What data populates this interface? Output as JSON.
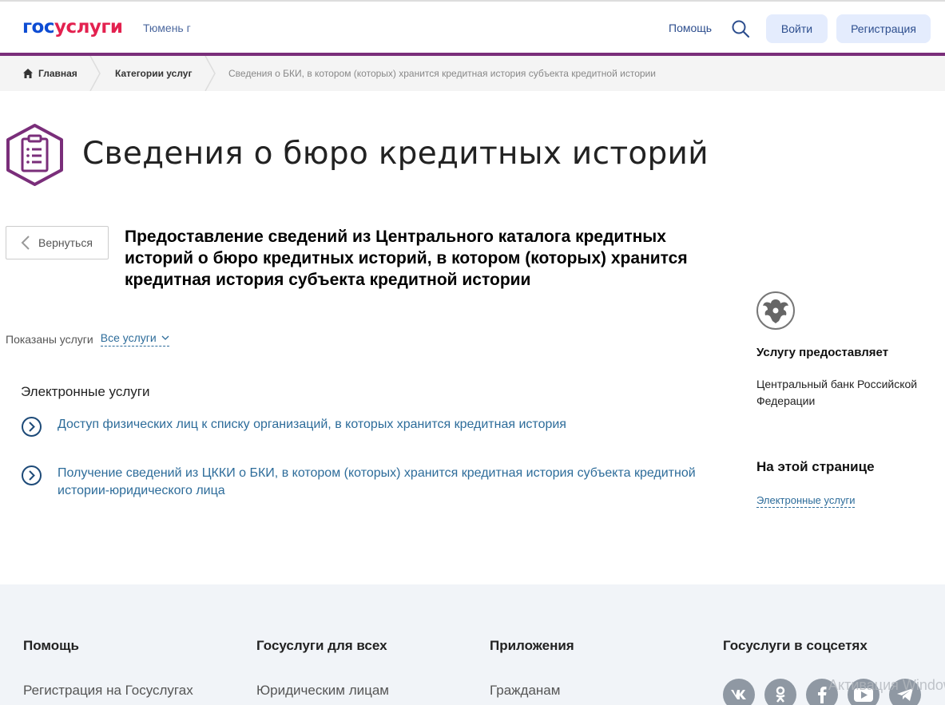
{
  "header": {
    "logo_part1": "гос",
    "logo_part2": "услуги",
    "city": "Тюмень г",
    "help": "Помощь",
    "login": "Войти",
    "register": "Регистрация"
  },
  "breadcrumbs": {
    "home": "Главная",
    "categories": "Категории услуг",
    "current": "Сведения о БКИ, в котором (которых) хранится кредитная история субъекта кредитной истории"
  },
  "page": {
    "title": "Сведения о бюро кредитных историй",
    "back": "Вернуться",
    "subtitle": "Предоставление сведений из Центрального каталога кредитных историй о бюро кредитных историй, в котором (которых) хранится кредитная история субъекта кредитной истории",
    "shown_label": "Показаны услуги",
    "filter": "Все услуги",
    "section_title": "Электронные услуги",
    "services": [
      "Доступ физических лиц к списку организаций, в которых хранится кредитная история",
      "Получение сведений из ЦККИ о БКИ, в котором (которых) хранится кредитная история субъекта кредитной истории-юридического лица"
    ]
  },
  "aside": {
    "provider_title": "Услугу предоставляет",
    "provider_name": "Центральный банк Российской Федерации",
    "onpage_title": "На этой странице",
    "onpage_link": "Электронные услуги"
  },
  "footer": {
    "columns": [
      {
        "title": "Помощь",
        "link": "Регистрация на Госуслугах"
      },
      {
        "title": "Госуслуги для всех",
        "link": "Юридическим лицам"
      },
      {
        "title": "Приложения",
        "link": "Гражданам"
      },
      {
        "title": "Госуслуги в соцсетях",
        "link": ""
      }
    ],
    "social": [
      "vk-icon",
      "ok-icon",
      "facebook-icon",
      "youtube-icon",
      "telegram-icon"
    ],
    "watermark": "Активация Windows"
  },
  "colors": {
    "brand_blue": "#0d4cd3",
    "brand_red": "#e3214f",
    "accent_purple": "#7a2e7a",
    "link": "#2d6c9a"
  }
}
